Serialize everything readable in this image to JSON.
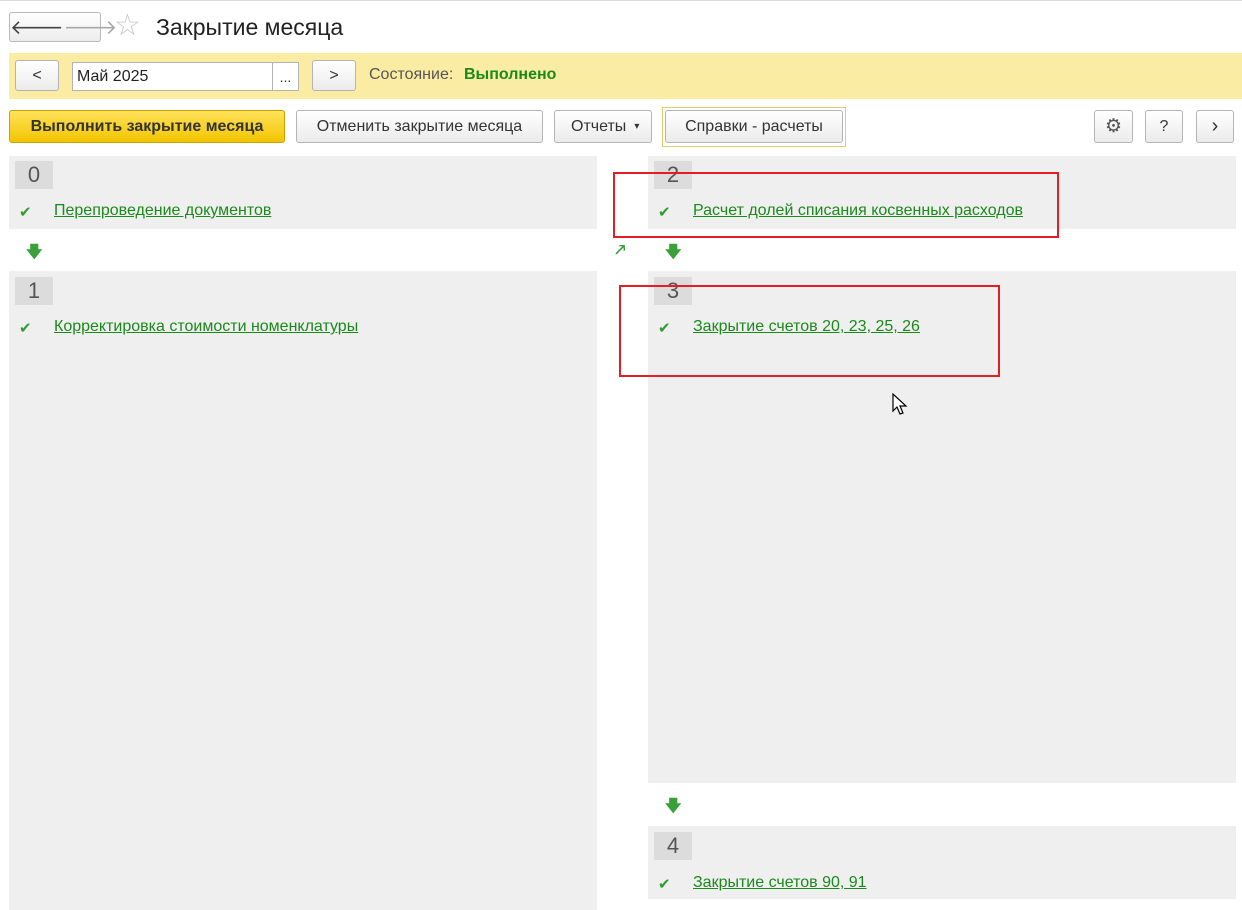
{
  "window": {
    "title": "Закрытие месяца",
    "nav_back": "🡐",
    "nav_forward": "🡒",
    "favorite_icon": "☆"
  },
  "period": {
    "prev_label": "<",
    "next_label": ">",
    "value": "Май 2025",
    "select_label": "...",
    "state_label": "Состояние:",
    "state_value": "Выполнено",
    "state_color": "#1a8a1a"
  },
  "toolbar": {
    "run_label": "Выполнить закрытие месяца",
    "cancel_label": "Отменить закрытие месяца",
    "reports_label": "Отчеты",
    "reports_dropdown": "▾",
    "spravki_label": "Справки - расчеты",
    "settings_icon": "⚙",
    "help_label": "?",
    "more_label": "›"
  },
  "stages": [
    {
      "number": "0",
      "items": [
        {
          "check": "✔",
          "label": "Перепроведение документов"
        }
      ]
    },
    {
      "number": "1",
      "items": [
        {
          "check": "✔",
          "label": "Корректировка стоимости номенклатуры"
        }
      ]
    },
    {
      "number": "2",
      "items": [
        {
          "check": "✔",
          "label": "Расчет долей списания косвенных расходов"
        }
      ]
    },
    {
      "number": "3",
      "items": [
        {
          "check": "✔",
          "label": "Закрытие счетов 20, 23, 25, 26"
        }
      ]
    },
    {
      "number": "4",
      "items": [
        {
          "check": "✔",
          "label": "Закрытие счетов 90, 91"
        }
      ]
    }
  ],
  "arrows": {
    "down": "🡇",
    "diagonal": "🡕"
  },
  "colors": {
    "accent_yellow": "#f2c500",
    "period_bar": "#fbeca3",
    "success_green": "#1b8a1b",
    "highlight_red": "#e31e24"
  }
}
